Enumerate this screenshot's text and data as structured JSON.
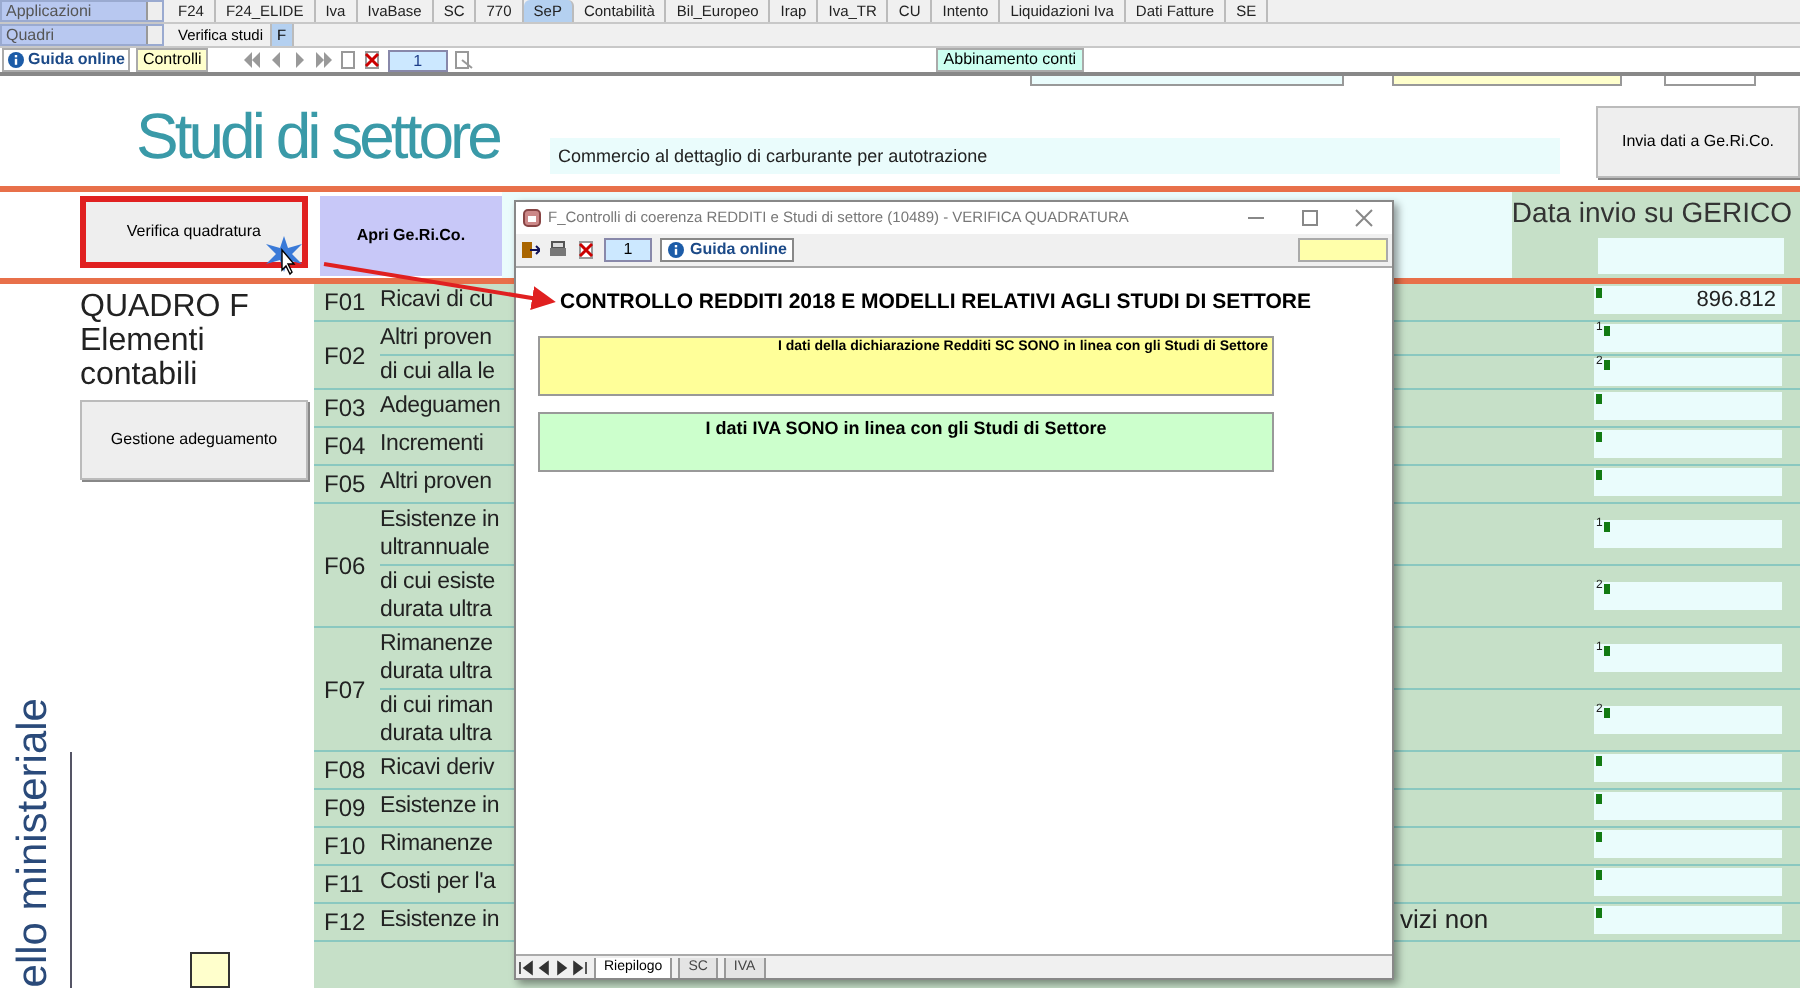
{
  "menus": [
    {
      "label": "Applicazioni"
    },
    {
      "label": "Quadri"
    }
  ],
  "app_tabs": [
    {
      "label": "F24",
      "selected": false
    },
    {
      "label": "F24_ELIDE",
      "selected": false
    },
    {
      "label": "Iva",
      "selected": false
    },
    {
      "label": "IvaBase",
      "selected": false
    },
    {
      "label": "SC",
      "selected": false
    },
    {
      "label": "770",
      "selected": false
    },
    {
      "label": "SeP",
      "selected": true
    },
    {
      "label": "Contabilità",
      "selected": false
    },
    {
      "label": "Bil_Europeo",
      "selected": false
    },
    {
      "label": "Irap",
      "selected": false
    },
    {
      "label": "Iva_TR",
      "selected": false
    },
    {
      "label": "CU",
      "selected": false
    },
    {
      "label": "Intento",
      "selected": false
    },
    {
      "label": "Liquidazioni Iva",
      "selected": false
    },
    {
      "label": "Dati Fatture",
      "selected": false
    },
    {
      "label": "SE",
      "selected": false
    }
  ],
  "quadri_tabs": [
    {
      "label": "Verifica studi",
      "selected": false
    },
    {
      "label": "F",
      "selected": true
    }
  ],
  "toolbar": {
    "help": "Guida online",
    "controls": "Controlli",
    "page": "1",
    "match_button": "Abbinamento conti"
  },
  "page": {
    "title": "Studi di settore",
    "activity": "Commercio al dettaglio di carburante per autotrazione",
    "send_button": "Invia dati a Ge.Ri.Co.",
    "check_button": "Verifica quadratura",
    "open_button": "Apri Ge.Ri.Co.",
    "send_date_label": "Data invio su GERICO",
    "section": "QUADRO F Elementi contabili",
    "adjust_button": "Gestione adeguamento",
    "model_label": "ello ministeriale"
  },
  "rows": [
    {
      "code": "F01",
      "parts": [
        {
          "lines": [
            "Ricavi di cu"
          ],
          "value": "896.812"
        }
      ]
    },
    {
      "code": "F02",
      "parts": [
        {
          "lines": [
            "Altri proven"
          ],
          "sup": "1"
        },
        {
          "lines": [
            "di cui alla le"
          ],
          "sup": "2"
        }
      ]
    },
    {
      "code": "F03",
      "parts": [
        {
          "lines": [
            "Adeguamen"
          ]
        }
      ]
    },
    {
      "code": "F04",
      "parts": [
        {
          "lines": [
            "Incrementi"
          ]
        }
      ]
    },
    {
      "code": "F05",
      "parts": [
        {
          "lines": [
            "Altri proven"
          ]
        }
      ]
    },
    {
      "code": "F06",
      "parts": [
        {
          "lines": [
            "Esistenze in",
            "ultrannuale"
          ],
          "sup": "1"
        },
        {
          "lines": [
            "di cui esiste",
            "durata ultra"
          ],
          "sup": "2"
        }
      ]
    },
    {
      "code": "F07",
      "parts": [
        {
          "lines": [
            "Rimanenze",
            "durata ultra"
          ],
          "sup": "1"
        },
        {
          "lines": [
            "di cui riman",
            "durata ultra"
          ],
          "sup": "2"
        }
      ]
    },
    {
      "code": "F08",
      "parts": [
        {
          "lines": [
            "Ricavi deriv"
          ]
        }
      ]
    },
    {
      "code": "F09",
      "parts": [
        {
          "lines": [
            "Esistenze in"
          ]
        }
      ]
    },
    {
      "code": "F10",
      "parts": [
        {
          "lines": [
            "Rimanenze"
          ]
        }
      ]
    },
    {
      "code": "F11",
      "parts": [
        {
          "lines": [
            "Costi per l'a"
          ]
        }
      ]
    },
    {
      "code": "F12",
      "parts": [
        {
          "lines": [
            "Esistenze in"
          ],
          "tail": "vizi non"
        }
      ]
    }
  ],
  "dialog": {
    "title": "F_Controlli di coerenza REDDITI e Studi di settore (10489) - VERIFICA QUADRATURA",
    "page": "1",
    "help": "Guida online",
    "heading": "CONTROLLO REDDITI 2018 E MODELLI RELATIVI AGLI STUDI DI SETTORE",
    "messages": [
      {
        "kind": "detail",
        "text": "I dati della dichiarazione Redditi SC  SONO  in linea con gli Studi di Settore",
        "color": "#ffff99"
      },
      {
        "kind": "summary",
        "text": "I dati IVA SONO in linea con gli Studi di Settore",
        "color": "#ccffcc"
      }
    ],
    "sheet_tabs": [
      {
        "label": "Riepilogo",
        "selected": true
      },
      {
        "label": "SC",
        "selected": false
      },
      {
        "label": "IVA",
        "selected": false
      }
    ]
  }
}
